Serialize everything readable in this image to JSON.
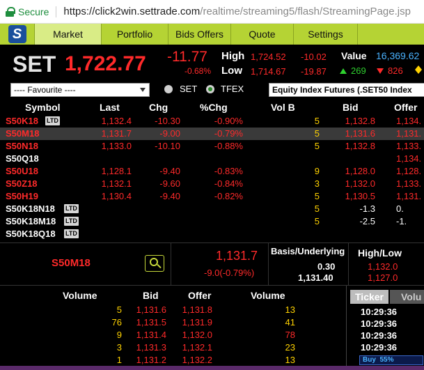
{
  "browser": {
    "secure_label": "Secure",
    "url_host": "https://click2win.settrade.com",
    "url_path": "/realtime/streaming5/flash/StreamingPage.jsp"
  },
  "nav": {
    "logo_text": "S",
    "tabs": [
      {
        "label": "Market"
      },
      {
        "label": "Portfolio"
      },
      {
        "label": "Bids Offers"
      },
      {
        "label": "Quote"
      },
      {
        "label": "Settings"
      }
    ]
  },
  "index": {
    "name": "SET",
    "value": "1,722.77",
    "change": "-11.77",
    "change_pct": "-0.68%",
    "high_label": "High",
    "high_value": "1,724.52",
    "high_diff": "-10.02",
    "low_label": "Low",
    "low_value": "1,714.67",
    "low_diff": "-19.87",
    "value_label": "Value",
    "value_num": "16,369.62",
    "up_count": "269",
    "down_count": "826"
  },
  "filter": {
    "favourite": "---- Favourite ----",
    "radio_set": "SET",
    "radio_tfex": "TFEX",
    "product": "Equity Index Futures (.SET50 Index"
  },
  "columns": {
    "symbol": "Symbol",
    "last": "Last",
    "chg": "Chg",
    "pchg": "%Chg",
    "vol_b": "Vol B",
    "bid": "Bid",
    "offer": "Offer"
  },
  "rows": [
    {
      "symbol": "S50K18",
      "ltd": "LTD",
      "last": "1,132.4",
      "chg": "-10.30",
      "pchg": "-0.90%",
      "vol_b": "5",
      "bid": "1,132.8",
      "offer": "1,134."
    },
    {
      "symbol": "S50M18",
      "ltd": "",
      "last": "1,131.7",
      "chg": "-9.00",
      "pchg": "-0.79%",
      "vol_b": "5",
      "bid": "1,131.6",
      "offer": "1,131."
    },
    {
      "symbol": "S50N18",
      "ltd": "",
      "last": "1,133.0",
      "chg": "-10.10",
      "pchg": "-0.88%",
      "vol_b": "5",
      "bid": "1,132.8",
      "offer": "1,133."
    },
    {
      "symbol": "S50Q18",
      "ltd": "",
      "last": "",
      "chg": "",
      "pchg": "",
      "vol_b": "",
      "bid": "",
      "offer": "1,134."
    },
    {
      "symbol": "S50U18",
      "ltd": "",
      "last": "1,128.1",
      "chg": "-9.40",
      "pchg": "-0.83%",
      "vol_b": "9",
      "bid": "1,128.0",
      "offer": "1,128."
    },
    {
      "symbol": "S50Z18",
      "ltd": "",
      "last": "1,132.1",
      "chg": "-9.60",
      "pchg": "-0.84%",
      "vol_b": "3",
      "bid": "1,132.0",
      "offer": "1,133."
    },
    {
      "symbol": "S50H19",
      "ltd": "",
      "last": "1,130.4",
      "chg": "-9.40",
      "pchg": "-0.82%",
      "vol_b": "5",
      "bid": "1,130.5",
      "offer": "1,131."
    },
    {
      "symbol": "S50K18N18",
      "ltd": "LTD",
      "last": "",
      "chg": "",
      "pchg": "",
      "vol_b": "5",
      "bid": "-1.3",
      "offer": "0."
    },
    {
      "symbol": "S50K18M18",
      "ltd": "LTD",
      "last": "",
      "chg": "",
      "pchg": "",
      "vol_b": "5",
      "bid": "-2.5",
      "offer": "-1."
    },
    {
      "symbol": "S50K18Q18",
      "ltd": "LTD",
      "last": "",
      "chg": "",
      "pchg": "",
      "vol_b": "",
      "bid": "",
      "offer": ""
    }
  ],
  "detail": {
    "symbol": "S50M18",
    "last": "1,131.7",
    "change": "-9.0(-0.79%)",
    "basis_label": "Basis/Underlying",
    "basis": "0.30",
    "underlying": "1,131.40",
    "hl_label": "High/Low",
    "high": "1,132.0",
    "low": "1,127.0"
  },
  "bidoffer": {
    "headers": {
      "volume_bid": "Volume",
      "bid": "Bid",
      "offer": "Offer",
      "volume_offer": "Volume"
    },
    "rows": [
      {
        "vol_bid": "5",
        "bid": "1,131.6",
        "offer": "1,131.8",
        "vol_offer": "13"
      },
      {
        "vol_bid": "76",
        "bid": "1,131.5",
        "offer": "1,131.9",
        "vol_offer": "41"
      },
      {
        "vol_bid": "9",
        "bid": "1,131.4",
        "offer": "1,132.0",
        "vol_offer": "78"
      },
      {
        "vol_bid": "3",
        "bid": "1,131.3",
        "offer": "1,132.1",
        "vol_offer": "23"
      },
      {
        "vol_bid": "1",
        "bid": "1,131.2",
        "offer": "1,132.2",
        "vol_offer": "13"
      }
    ]
  },
  "ticker": {
    "tab_ticker": "Ticker",
    "tab_volume": "Volu",
    "times": [
      "10:29:36",
      "10:29:36",
      "10:29:36",
      "10:29:36"
    ],
    "buy_label": "Buy",
    "buy_pct": "55%",
    "buy_fraction": 0.55
  }
}
